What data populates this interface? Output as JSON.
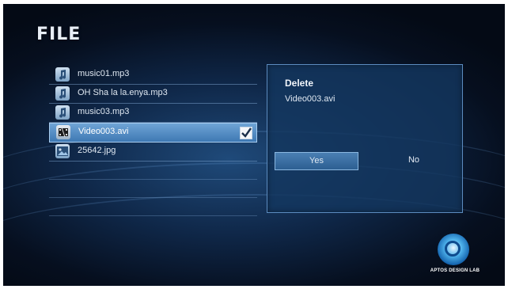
{
  "header": {
    "title": "FILE"
  },
  "files": [
    {
      "name": "music01.mp3",
      "icon": "music-file-icon"
    },
    {
      "name": "OH Sha la la.enya.mp3",
      "icon": "music-file-icon"
    },
    {
      "name": "music03.mp3",
      "icon": "music-file-icon"
    },
    {
      "name": "Video003.avi",
      "icon": "video-file-icon",
      "selected": true,
      "checked": true
    },
    {
      "name": "25642.jpg",
      "icon": "image-file-icon"
    }
  ],
  "dialog": {
    "title": "Delete",
    "filename": "Video003.avi",
    "yes_label": "Yes",
    "no_label": "No"
  },
  "brand": {
    "logo_text": "APTOS DESIGN LAB"
  },
  "colors": {
    "background": "#0f2748",
    "accent": "#3e78b3",
    "dialog_border": "#5c8cc0"
  }
}
